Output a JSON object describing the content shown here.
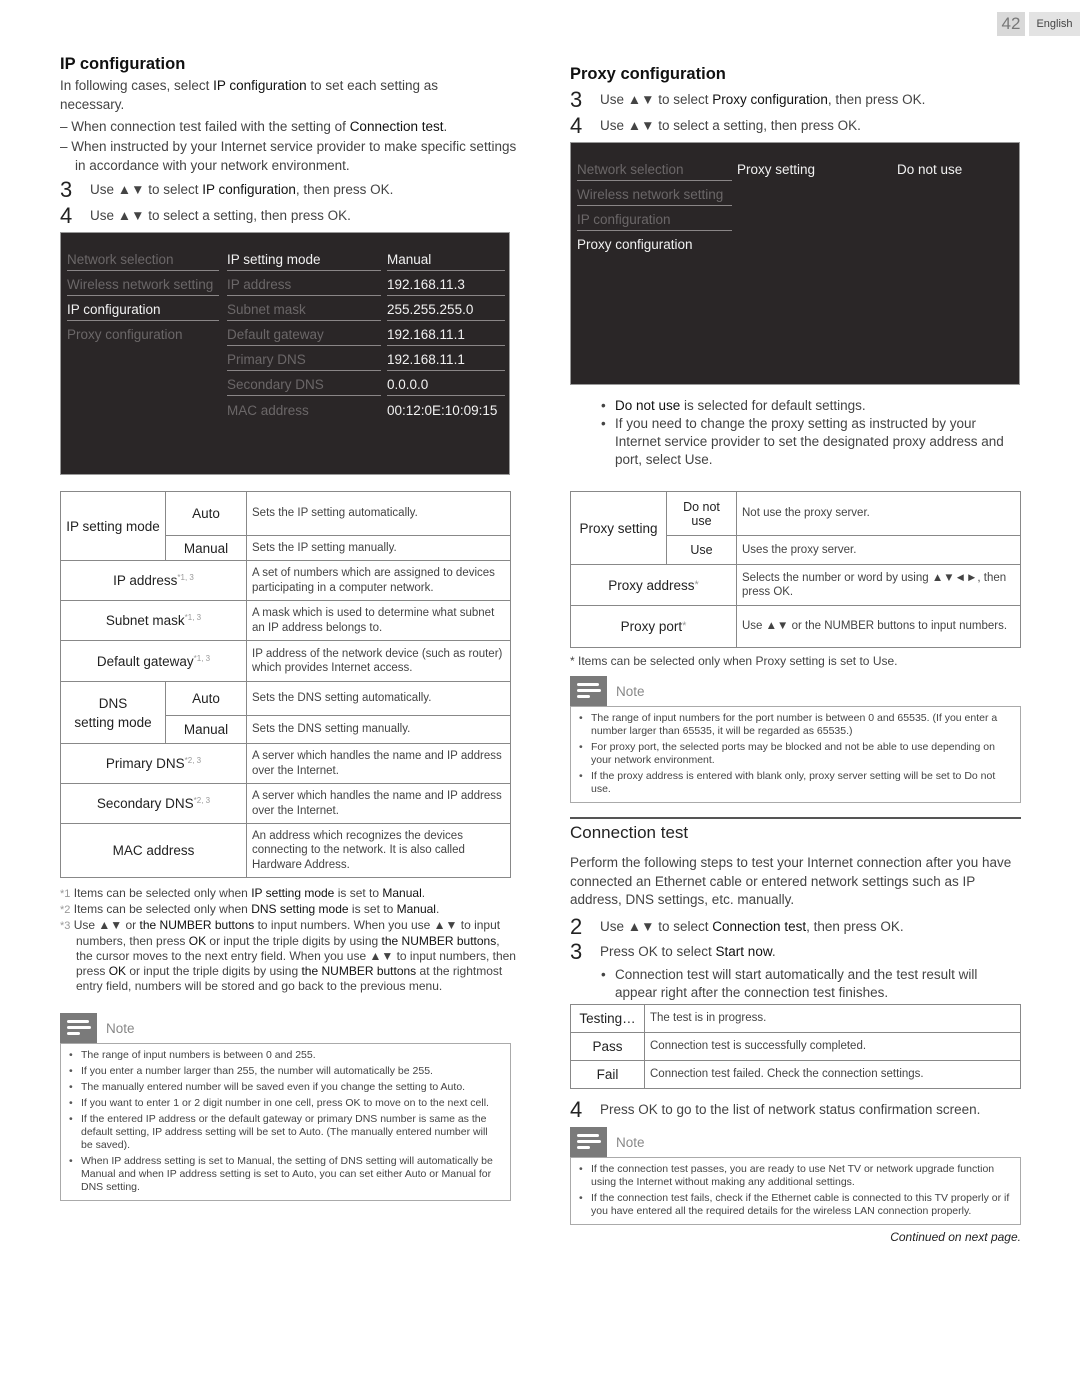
{
  "header": {
    "page_number": "42",
    "language": "English"
  },
  "ip_config": {
    "title": "IP configuration",
    "intro_pre": "In following cases, select ",
    "intro_bold": "IP configuration",
    "intro_post": " to set each setting as necessary.",
    "dashes": [
      {
        "pre": "When connection test failed with the setting of ",
        "bold": "Connection test",
        "post": "."
      },
      {
        "pre": "When instructed by your Internet service provider to make specific settings in accordance with your network environment.",
        "bold": "",
        "post": ""
      }
    ],
    "steps": [
      {
        "num": "3",
        "pre": "Use ▲▼ to select ",
        "bold": "IP configuration",
        "post": ", then press OK."
      },
      {
        "num": "4",
        "pre": "Use ▲▼ to select a setting, then press OK.",
        "bold": "",
        "post": ""
      }
    ],
    "screen": {
      "menu": [
        {
          "label": "Network selection",
          "active": false
        },
        {
          "label": "Wireless network setting",
          "active": false
        },
        {
          "label": "IP configuration",
          "active": true
        },
        {
          "label": "Proxy configuration",
          "active": false
        }
      ],
      "settings": [
        {
          "label": "IP setting mode",
          "value": "Manual",
          "active": true
        },
        {
          "label": "IP address",
          "value": "192.168.11.3",
          "active": false
        },
        {
          "label": "Subnet mask",
          "value": "255.255.255.0",
          "active": false
        },
        {
          "label": "Default gateway",
          "value": "192.168.11.1",
          "active": false
        },
        {
          "label": "Primary DNS",
          "value": "192.168.11.1",
          "active": false
        },
        {
          "label": "Secondary DNS",
          "value": "0.0.0.0",
          "active": false
        },
        {
          "label": "MAC address",
          "value": "00:12:0E:10:09:15",
          "active": false
        }
      ]
    },
    "table": {
      "ip_mode": {
        "name": "IP setting mode",
        "auto": "Auto",
        "auto_desc": "Sets the IP setting automatically.",
        "manual": "Manual",
        "manual_desc": "Sets the IP setting manually."
      },
      "ip_address": {
        "name": "IP address",
        "mark": "*1, 3",
        "desc": "A set of numbers which are assigned to devices participating in a computer network."
      },
      "subnet": {
        "name": "Subnet mask",
        "mark": "*1, 3",
        "desc": "A mask which is used to determine what subnet an IP address belongs to."
      },
      "gateway": {
        "name": "Default gateway",
        "mark": "*1, 3",
        "desc": "IP address of the network device (such as router) which provides Internet access."
      },
      "dns_mode": {
        "name_line1": "DNS",
        "name_line2": "setting mode",
        "auto": "Auto",
        "auto_desc": "Sets the DNS setting automatically.",
        "manual": "Manual",
        "manual_desc": "Sets the DNS setting manually."
      },
      "primary_dns": {
        "name": "Primary DNS",
        "mark": "*2, 3",
        "desc": "A server which handles the name and IP address over the Internet."
      },
      "secondary_dns": {
        "name": "Secondary DNS",
        "mark": "*2, 3",
        "desc": "A server which handles the name and IP address over the Internet."
      },
      "mac": {
        "name": "MAC address",
        "desc": "An address which recognizes the devices connecting to the network. It is also called Hardware Address."
      }
    },
    "footnotes": {
      "f1_mark": "*1",
      "f1_pre": "Items can be selected only when ",
      "f1_bold": "IP setting mode",
      "f1_mid": " is set to ",
      "f1_bold2": "Manual",
      "f1_post": ".",
      "f2_mark": "*2",
      "f2_pre": "Items can be selected only when ",
      "f2_bold": "DNS setting mode",
      "f2_mid": " is set to ",
      "f2_bold2": "Manual",
      "f2_post": ".",
      "f3_mark": "*3",
      "f3_text_a": "Use ▲▼ or ",
      "f3_bold_a": "the NUMBER buttons",
      "f3_text_b": " to input numbers. When you use ▲▼ to input numbers, then press ",
      "f3_bold_b": "OK",
      "f3_text_c": " or input the triple digits by using ",
      "f3_bold_c": "the NUMBER buttons",
      "f3_text_d": ", the cursor moves to the next entry field. When you use ▲▼ to input numbers, then press ",
      "f3_bold_d": "OK",
      "f3_text_e": " or input the triple digits by using ",
      "f3_bold_e": "the NUMBER buttons",
      "f3_text_f": " at the rightmost entry field, numbers will be stored and go back to the previous menu."
    },
    "note": {
      "label": "Note",
      "items": [
        "The range of input numbers is between 0 and 255.",
        "If you enter a number larger than 255, the number will automatically be 255.",
        "The manually entered number will be saved even if you change the setting to Auto.",
        "If you want to enter 1 or 2 digit number in one cell, press OK to move on to the next cell.",
        "If the entered IP address or the default gateway or primary DNS number is same as the default setting, IP address setting will be set to Auto. (The manually entered number will be saved).",
        "When IP address setting is set to Manual, the setting of DNS setting will automatically be Manual and when IP address setting is set to Auto, you can set either Auto or Manual for DNS setting."
      ]
    }
  },
  "proxy_config": {
    "title": "Proxy configuration",
    "steps": [
      {
        "num": "3",
        "pre": "Use ▲▼ to select ",
        "bold": "Proxy configuration",
        "post": ", then press OK."
      },
      {
        "num": "4",
        "pre": "Use ▲▼ to select a setting, then press OK.",
        "bold": "",
        "post": ""
      }
    ],
    "screen": {
      "menu": [
        {
          "label": "Network selection",
          "active": false
        },
        {
          "label": "Wireless network setting",
          "active": false
        },
        {
          "label": "IP configuration",
          "active": false
        },
        {
          "label": "Proxy configuration",
          "active": true
        }
      ],
      "setting_label": "Proxy setting",
      "setting_value": "Do not use"
    },
    "bullets": [
      {
        "bold": "Do not use",
        "text": " is selected for default settings."
      },
      {
        "bold": "",
        "text": "If you need to change the proxy setting as instructed by your Internet service provider to set the designated proxy address and port, select Use."
      }
    ],
    "table": {
      "proxy_setting": {
        "name": "Proxy setting",
        "opt1": "Do not use",
        "opt1_desc": "Not use the proxy server.",
        "opt2": "Use",
        "opt2_desc": "Uses the proxy server."
      },
      "proxy_address": {
        "name": "Proxy address",
        "mark": "*",
        "desc": "Selects the number or word by using ▲▼◄►, then press OK."
      },
      "proxy_port": {
        "name": "Proxy port",
        "mark": "*",
        "desc": "Use ▲▼ or the NUMBER buttons to input numbers."
      }
    },
    "footnote": "* Items can be selected only when Proxy setting is set to Use.",
    "note": {
      "label": "Note",
      "items": [
        "The range of input numbers for the port number is between 0 and 65535. (If you enter a number larger than 65535, it will be regarded as 65535.)",
        "For proxy port, the selected ports may be blocked and not be able to use depending on your network environment.",
        "If the proxy address is entered with blank only, proxy server setting will be set to Do not use."
      ]
    }
  },
  "connection_test": {
    "title": "Connection test",
    "intro": "Perform the following steps to test your Internet connection after you have connected an Ethernet cable or entered network settings such as IP address, DNS settings, etc. manually.",
    "steps": [
      {
        "num": "2",
        "pre": "Use ▲▼ to select ",
        "bold": "Connection test",
        "post": ", then press OK."
      },
      {
        "num": "3",
        "pre": "Press OK to select ",
        "bold": "Start now",
        "post": "."
      }
    ],
    "sub_bullet": "Connection test will start automatically and the test result will appear right after the connection test finishes.",
    "results": [
      {
        "status": "Testing…",
        "desc": "The test is in progress."
      },
      {
        "status": "Pass",
        "desc": "Connection test is successfully completed."
      },
      {
        "status": "Fail",
        "desc": "Connection test failed. Check the connection settings."
      }
    ],
    "step4": {
      "num": "4",
      "text": "Press OK to go to the list of network status confirmation screen."
    },
    "note": {
      "label": "Note",
      "items": [
        "If the connection test passes, you are ready to use Net TV or network upgrade function using the Internet without making any additional settings.",
        "If the connection test fails, check if the Ethernet cable is connected to this TV properly or if you have entered all the required details for the wireless LAN connection properly."
      ]
    }
  },
  "footer": {
    "continued": "Continued on next page."
  }
}
